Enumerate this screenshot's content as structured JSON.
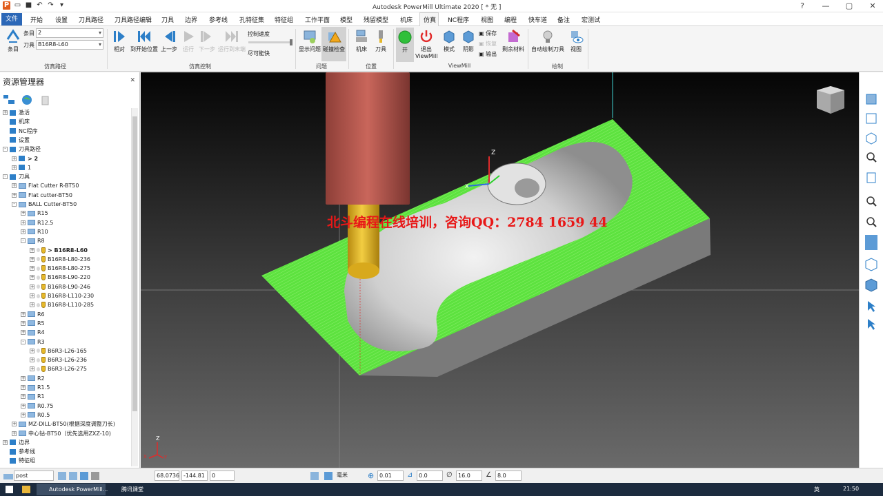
{
  "title": {
    "text": "Autodesk PowerMill Ultimate 2020  [ * 无 ]"
  },
  "ribbon_tabs": [
    "文件",
    "开始",
    "设置",
    "刀具路径",
    "刀具路径编辑",
    "刀具",
    "边界",
    "参考线",
    "孔特征集",
    "特征组",
    "工作平面",
    "模型",
    "残留模型",
    "机床",
    "仿真",
    "NC程序",
    "视图",
    "编程",
    "快车道",
    "备注",
    "宏测试"
  ],
  "ribbon": {
    "path_label": "条目",
    "path_value": "2",
    "tool_label": "刀具",
    "tool_value": "B16R8-L60",
    "item_btn": "条目",
    "relative": "相对",
    "to_start": "到开始位置",
    "prev": "上一步",
    "play": "运行",
    "next": "下一步",
    "to_end": "运行到末端",
    "speed_label": "控制速度",
    "speed_value": "尽可能快",
    "show_issues": "显示问题",
    "collision": "碰撞检查",
    "machine": "机床",
    "tool": "刀具",
    "on": "开",
    "exit1": "退出",
    "exit2": "ViewMill",
    "mode": "模式",
    "shadow": "阴影",
    "save": "保存",
    "restore": "恢复",
    "export": "输出",
    "stock": "剩余材料",
    "auto_draw": "自动绘制刀具",
    "view": "视图",
    "grp_sim_path": "仿真路径",
    "grp_sim_ctrl": "仿真控制",
    "grp_issue": "问题",
    "grp_pos": "位置",
    "grp_viewmill": "ViewMill",
    "grp_draw": "绘制"
  },
  "explorer": {
    "title": "资源管理器",
    "tree": [
      {
        "label": "激活",
        "indent": 0,
        "pm": "+"
      },
      {
        "label": "机床",
        "indent": 0,
        "pm": ""
      },
      {
        "label": "NC程序",
        "indent": 0,
        "pm": ""
      },
      {
        "label": "设置",
        "indent": 0,
        "pm": ""
      },
      {
        "label": "刀具路径",
        "indent": 0,
        "pm": "-"
      },
      {
        "label": "> 2",
        "indent": 1,
        "pm": "+",
        "bold": true
      },
      {
        "label": "1",
        "indent": 1,
        "pm": "+"
      },
      {
        "label": "刀具",
        "indent": 0,
        "pm": "-"
      },
      {
        "label": "Flat Cutter R-BT50",
        "indent": 1,
        "pm": "+",
        "folder": true
      },
      {
        "label": "Flat cutter-BT50",
        "indent": 1,
        "pm": "+",
        "folder": true
      },
      {
        "label": "BALL Cutter-BT50",
        "indent": 1,
        "pm": "-",
        "folder": true
      },
      {
        "label": "R15",
        "indent": 2,
        "pm": "+",
        "folder": true
      },
      {
        "label": "R12.5",
        "indent": 2,
        "pm": "+",
        "folder": true
      },
      {
        "label": "R10",
        "indent": 2,
        "pm": "+",
        "folder": true
      },
      {
        "label": "R8",
        "indent": 2,
        "pm": "-",
        "folder": true
      },
      {
        "label": "> B16R8-L60",
        "indent": 3,
        "pm": "+",
        "tool": true,
        "bold": true
      },
      {
        "label": "B16R8-L80-236",
        "indent": 3,
        "pm": "+",
        "tool": true
      },
      {
        "label": "B16R8-L80-275",
        "indent": 3,
        "pm": "+",
        "tool": true
      },
      {
        "label": "B16R8-L90-220",
        "indent": 3,
        "pm": "+",
        "tool": true
      },
      {
        "label": "B16R8-L90-246",
        "indent": 3,
        "pm": "+",
        "tool": true
      },
      {
        "label": "B16R8-L110-230",
        "indent": 3,
        "pm": "+",
        "tool": true
      },
      {
        "label": "B16R8-L110-285",
        "indent": 3,
        "pm": "+",
        "tool": true
      },
      {
        "label": "R6",
        "indent": 2,
        "pm": "+",
        "folder": true
      },
      {
        "label": "R5",
        "indent": 2,
        "pm": "+",
        "folder": true
      },
      {
        "label": "R4",
        "indent": 2,
        "pm": "+",
        "folder": true
      },
      {
        "label": "R3",
        "indent": 2,
        "pm": "-",
        "folder": true
      },
      {
        "label": "B6R3-L26-165",
        "indent": 3,
        "pm": "+",
        "tool": true
      },
      {
        "label": "B6R3-L26-236",
        "indent": 3,
        "pm": "+",
        "tool": true
      },
      {
        "label": "B6R3-L26-275",
        "indent": 3,
        "pm": "+",
        "tool": true
      },
      {
        "label": "R2",
        "indent": 2,
        "pm": "+",
        "folder": true
      },
      {
        "label": "R1.5",
        "indent": 2,
        "pm": "+",
        "folder": true
      },
      {
        "label": "R1",
        "indent": 2,
        "pm": "+",
        "folder": true
      },
      {
        "label": "R0.75",
        "indent": 2,
        "pm": "+",
        "folder": true
      },
      {
        "label": "R0.5",
        "indent": 2,
        "pm": "+",
        "folder": true
      },
      {
        "label": "MZ-DILL-BT50(根据深度调整刀长)",
        "indent": 1,
        "pm": "+",
        "folder": true
      },
      {
        "label": "中心钻-BT50（优先选用ZXZ-10)",
        "indent": 1,
        "pm": "+",
        "folder": true
      },
      {
        "label": "边界",
        "indent": 0,
        "pm": "+"
      },
      {
        "label": "参考线",
        "indent": 0,
        "pm": ""
      },
      {
        "label": "特征组",
        "indent": 0,
        "pm": ""
      }
    ]
  },
  "viewport": {
    "watermark": "北斗编程在线培训，咨询QQ：2784 1659 44",
    "axis_z": "Z",
    "axis_x": "X",
    "axis_y": "Y"
  },
  "status": {
    "post": "post",
    "x": "68.0736",
    "y": "-144.81",
    "z": "0",
    "unit": "毫米",
    "tol": "0.01",
    "thick": "0.0",
    "dia": "16.0",
    "len": "8.0"
  },
  "taskbar": {
    "app1": "Autodesk PowerMill...",
    "app2": "腾讯课堂",
    "ime": "英",
    "clock": "21:50"
  }
}
